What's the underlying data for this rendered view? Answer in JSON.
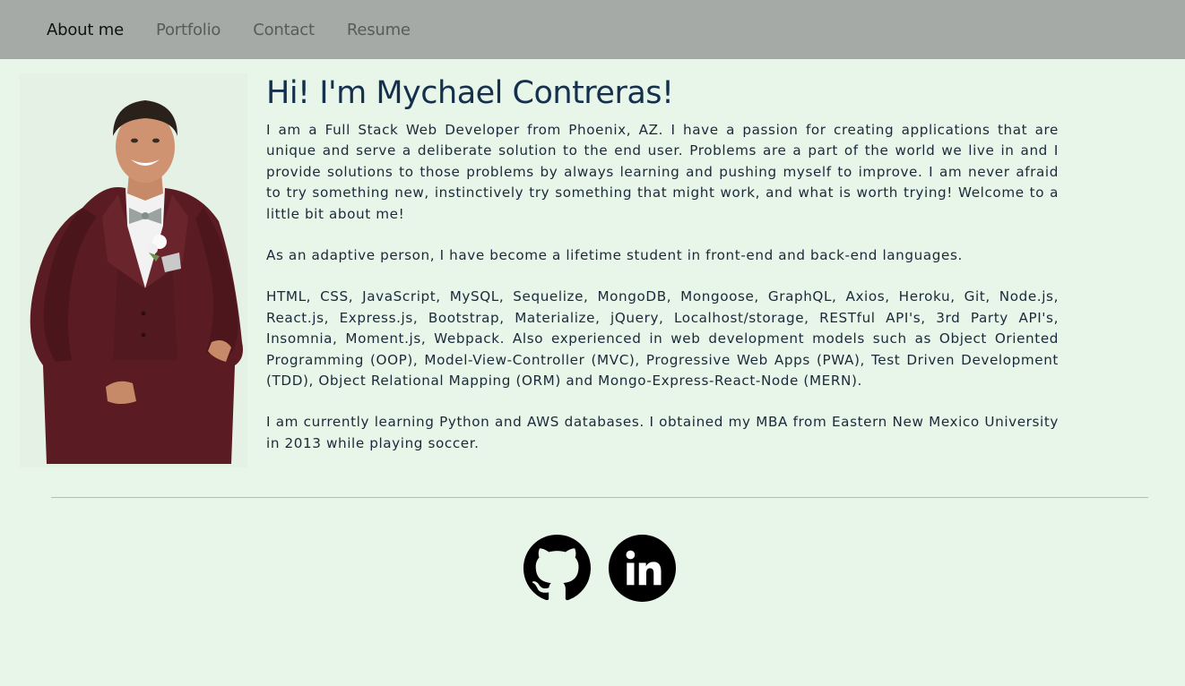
{
  "nav": {
    "items": [
      {
        "label": "About me",
        "active": true
      },
      {
        "label": "Portfolio",
        "active": false
      },
      {
        "label": "Contact",
        "active": false
      },
      {
        "label": "Resume",
        "active": false
      }
    ]
  },
  "about": {
    "heading": "Hi! I'm Mychael Contreras!",
    "paragraphs": [
      "I am a Full Stack Web Developer from Phoenix, AZ. I have a passion for creating applications that are unique and serve a deliberate solution to the end user. Problems are a part of the world we live in and I provide solutions to those problems by always learning and pushing myself to improve. I am never afraid to try something new, instinctively try something that might work, and what is worth trying! Welcome to a little bit about me!",
      "As an adaptive person, I have become a lifetime student in front-end and back-end languages.",
      "HTML, CSS, JavaScript, MySQL, Sequelize, MongoDB, Mongoose, GraphQL, Axios, Heroku, Git, Node.js, React.js, Express.js, Bootstrap, Materialize, jQuery, Localhost/storage, RESTful API's, 3rd Party API's, Insomnia, Moment.js, Webpack. Also experienced in web development models such as Object Oriented Programming (OOP), Model-View-Controller (MVC), Progressive Web Apps (PWA), Test Driven Development (TDD), Object Relational Mapping (ORM) and Mongo-Express-React-Node (MERN).",
      "I am currently learning Python and AWS databases. I obtained my MBA from Eastern New Mexico University in 2013 while playing soccer."
    ]
  },
  "social": {
    "icons": [
      "github-icon",
      "linkedin-icon"
    ]
  },
  "colors": {
    "navbar_bg": "#a5aaa7",
    "page_bg": "#e8f5e9",
    "heading": "#14304d",
    "suit": "#5a1c22"
  }
}
